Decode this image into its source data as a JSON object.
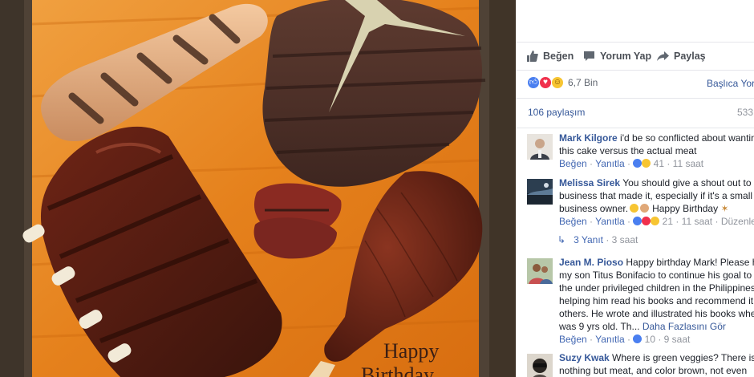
{
  "actions": {
    "like": "Beğen",
    "comment": "Yorum Yap",
    "share": "Paylaş"
  },
  "reactions": {
    "count": "6,7 Bin",
    "top_comments_link": "Başlıca Yor"
  },
  "shares": {
    "text": "106 paylaşım",
    "views_partial": "533"
  },
  "cake_text": {
    "line1": "Happy",
    "line2": "Birthday"
  },
  "comments": [
    {
      "name": "Mark Kilgore",
      "line1": "i'd be so conflicted about wantin",
      "line2": "this cake versus the actual meat",
      "like": "Beğen",
      "reply": "Yanıtla",
      "count": "41",
      "time": "11 saat"
    },
    {
      "name": "Melissa Sirek",
      "line1": "You should give a shout out to t",
      "line2": "business that made it, especially if it's a small",
      "line3": "business owner.",
      "line3b": "Happy Birthday",
      "like": "Beğen",
      "reply": "Yanıtla",
      "count": "21",
      "time": "11 saat",
      "edit": "Düzenlen"
    },
    {
      "name": "Jean M. Pioso",
      "line1": "Happy birthday Mark! Please h",
      "line2": "my son Titus Bonifacio to continue his goal to",
      "line3": "the under privileged children in the Philippines",
      "line4": "helping him read his books and recommend it",
      "line5": "others. He wrote and illustrated his books whe",
      "line6": "was 9 yrs old. Th...",
      "see_more": "Daha Fazlasını Gör",
      "like": "Beğen",
      "reply": "Yanıtla",
      "count": "10",
      "time": "9 saat"
    },
    {
      "name": "Suzy Kwak",
      "line1": "Where is green veggies? There is",
      "line2": "nothing but meat, and color brown, not even"
    }
  ],
  "replies": {
    "label": "3 Yanıt",
    "time": "3 saat"
  },
  "colors": {
    "link": "#365899",
    "like_blue": "#4267b2",
    "meta_gray": "#90949c",
    "cake_board": "#e07b16"
  }
}
